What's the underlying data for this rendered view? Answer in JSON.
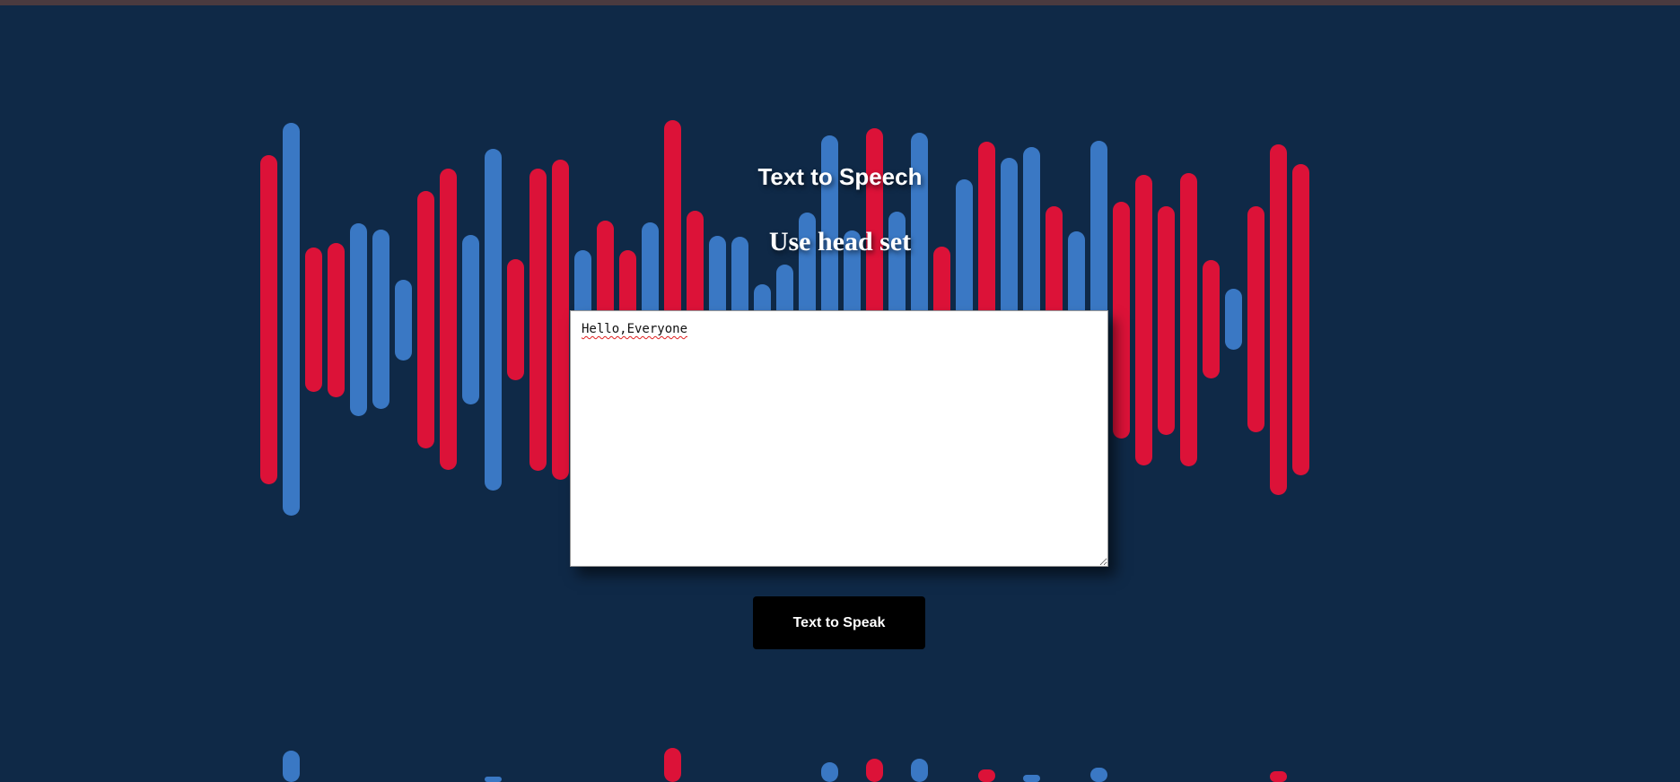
{
  "page": {
    "title": "Text to Speech",
    "subtitle": "Use head set"
  },
  "textarea": {
    "value": "Hello,Everyone"
  },
  "button": {
    "speak_label": "Text to Speak"
  },
  "colors": {
    "background": "#0f2947",
    "bar_red": "#dc1238",
    "bar_blue": "#3a78c4",
    "button_bg": "#000000",
    "top_border": "#4a3a3f"
  }
}
